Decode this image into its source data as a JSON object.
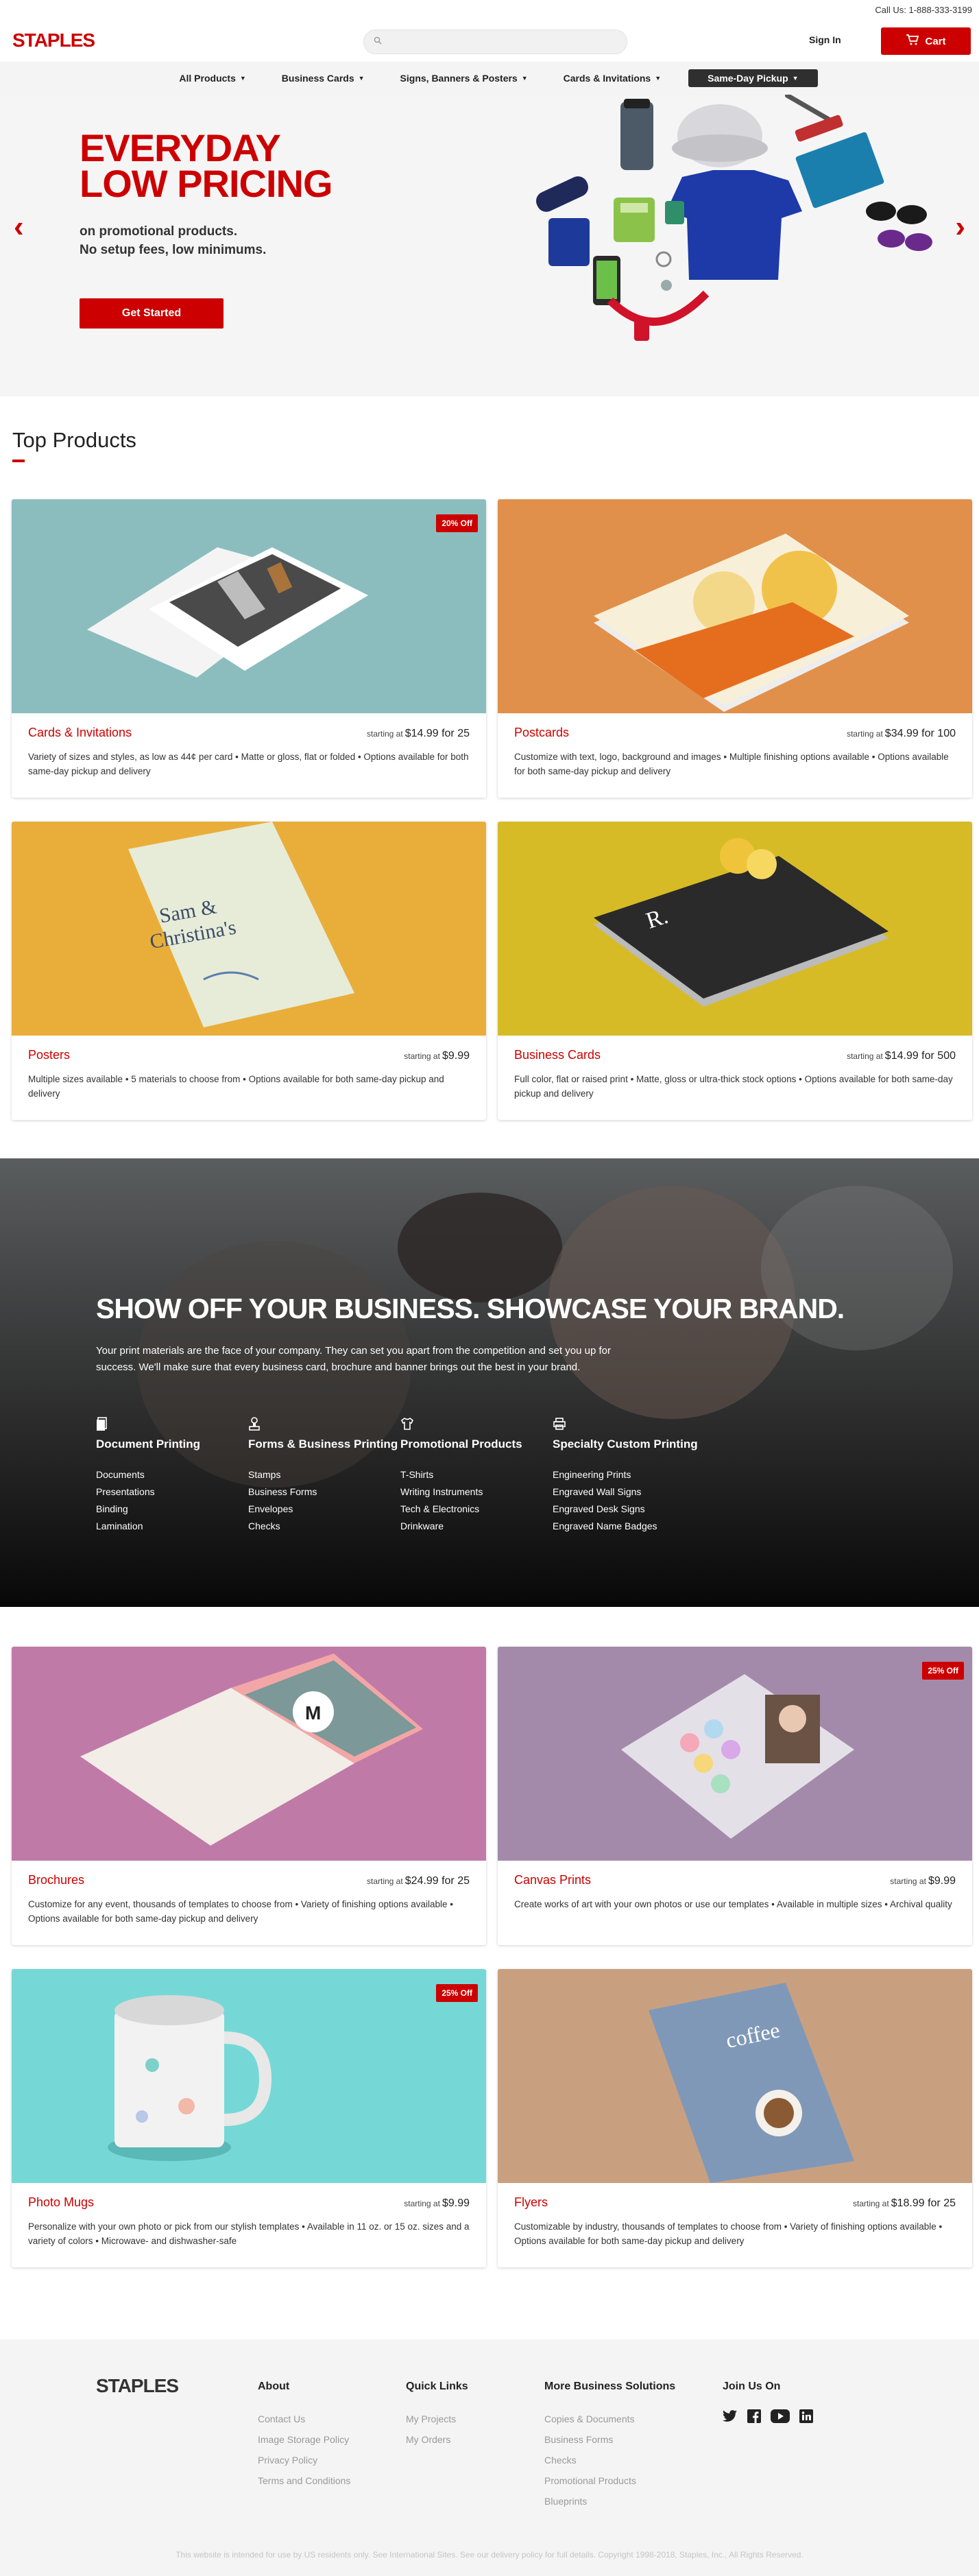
{
  "topbar": {
    "phone": "Call Us: 1-888-333-3199"
  },
  "header": {
    "logo": "STAPLES",
    "search_placeholder": "",
    "signin": "Sign In",
    "cart": "Cart"
  },
  "nav": [
    {
      "label": "All Products"
    },
    {
      "label": "Business Cards"
    },
    {
      "label": "Signs, Banners & Posters"
    },
    {
      "label": "Cards & Invitations"
    },
    {
      "label": "Same-Day Pickup"
    }
  ],
  "hero": {
    "title_line1": "EVERYDAY",
    "title_line2": "LOW PRICING",
    "sub_line1": "on promotional products.",
    "sub_line2": "No setup fees, low minimums.",
    "button": "Get Started"
  },
  "top_products_title": "Top Products",
  "products": [
    {
      "title": "Cards & Invitations",
      "price_prefix": "starting at",
      "price": "$14.99 for 25",
      "desc": "Variety of sizes and styles, as low as 44¢ per card • Matte or gloss, flat or folded • Options available for both same-day pickup and delivery",
      "badge": "20% Off",
      "color": "#8bbdbe"
    },
    {
      "title": "Postcards",
      "price_prefix": "starting at",
      "price": "$34.99 for 100",
      "desc": "Customize with text, logo, background and images • Multiple finishing options available • Options available for both same-day pickup and delivery",
      "badge": "",
      "color": "#e0904a"
    },
    {
      "title": "Posters",
      "price_prefix": "starting at",
      "price": "$9.99",
      "desc": "Multiple sizes available • 5 materials to choose from • Options available for both same-day pickup and delivery",
      "badge": "",
      "color": "#e9ae3a"
    },
    {
      "title": "Business Cards",
      "price_prefix": "starting at",
      "price": "$14.99 for 500",
      "desc": "Full color, flat or raised print • Matte, gloss or ultra-thick stock options • Options available for both same-day pickup and delivery",
      "badge": "",
      "color": "#d7bb26"
    }
  ],
  "banner": {
    "title": "SHOW OFF YOUR BUSINESS. SHOWCASE YOUR BRAND.",
    "text": "Your print materials are the face of your company. They can set you apart from the competition and set you up for success. We'll make sure that every business card, brochure and banner brings out the best in your brand.",
    "columns": [
      {
        "title": "Document Printing",
        "items": [
          "Documents",
          "Presentations",
          "Binding",
          "Lamination"
        ]
      },
      {
        "title": "Forms & Business Printing",
        "items": [
          "Stamps",
          "Business Forms",
          "Envelopes",
          "Checks"
        ]
      },
      {
        "title": "Promotional Products",
        "items": [
          "T-Shirts",
          "Writing Instruments",
          "Tech & Electronics",
          "Drinkware"
        ]
      },
      {
        "title": "Specialty Custom Printing",
        "items": [
          "Engineering Prints",
          "Engraved Wall Signs",
          "Engraved Desk Signs",
          "Engraved Name Badges"
        ]
      }
    ]
  },
  "products2": [
    {
      "title": "Brochures",
      "price_prefix": "starting at",
      "price": "$24.99 for 25",
      "desc": "Customize for any event, thousands of templates to choose from • Variety of finishing options available • Options available for both same-day pickup and delivery",
      "badge": "",
      "color": "#c07aa8"
    },
    {
      "title": "Canvas Prints",
      "price_prefix": "starting at",
      "price": "$9.99",
      "desc": "Create works of art with your own photos or use our templates • Available in multiple sizes • Archival quality",
      "badge": "25% Off",
      "color": "#a48aaa"
    },
    {
      "title": "Photo Mugs",
      "price_prefix": "starting at",
      "price": "$9.99",
      "desc": "Personalize with your own photo or pick from our stylish templates • Available in 11 oz. or 15 oz. sizes and a variety of colors • Microwave- and dishwasher-safe",
      "badge": "25% Off",
      "color": "#76d8d6"
    },
    {
      "title": "Flyers",
      "price_prefix": "starting at",
      "price": "$18.99 for 25",
      "desc": "Customizable by industry, thousands of templates to choose from • Variety of finishing options available • Options available for both same-day pickup and delivery",
      "badge": "",
      "color": "#c9a07f"
    }
  ],
  "footer": {
    "logo": "STAPLES",
    "about": {
      "title": "About",
      "items": [
        "Contact Us",
        "Image Storage Policy",
        "Privacy Policy",
        "Terms and Conditions"
      ]
    },
    "quick": {
      "title": "Quick Links",
      "items": [
        "My Projects",
        "My Orders"
      ]
    },
    "more": {
      "title": "More Business Solutions",
      "items": [
        "Copies & Documents",
        "Business Forms",
        "Checks",
        "Promotional Products",
        "Blueprints"
      ]
    },
    "join": {
      "title": "Join Us On"
    },
    "copyright": "This website is intended for use by US residents only. See International Sites. See our delivery policy for full details. Copyright 1998-2018, Staples, Inc., All Rights Reserved."
  }
}
